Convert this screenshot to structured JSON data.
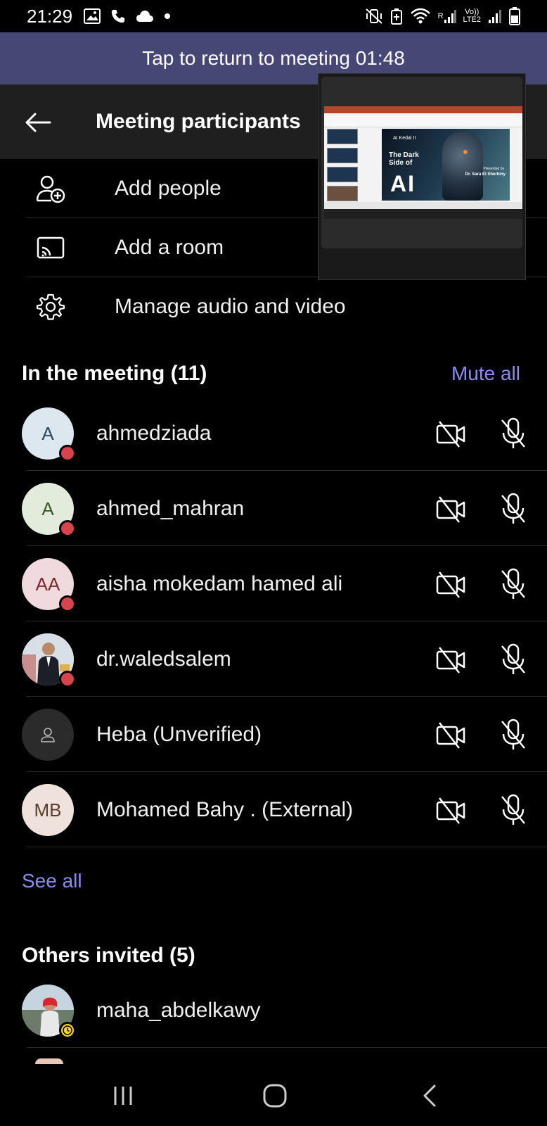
{
  "status_bar": {
    "time": "21:29",
    "network_label_top": "Vo))",
    "network_label_bottom": "LTE2",
    "roaming_label": "R"
  },
  "banner": {
    "text": "Tap to return to meeting 01:48"
  },
  "header": {
    "title": "Meeting participants"
  },
  "actions": [
    {
      "label": "Add people",
      "icon": "add-person-icon"
    },
    {
      "label": "Add a room",
      "icon": "cast-icon"
    },
    {
      "label": "Manage audio and video",
      "icon": "gear-icon"
    }
  ],
  "pip": {
    "slide_kicker": "AI Kedal II",
    "slide_title_line1": "The Dark",
    "slide_title_line2": "Side of",
    "slide_big": "AI",
    "slide_presented": "Presented by",
    "slide_presenter": "Dr. Sara El Sherbiny"
  },
  "in_meeting": {
    "title": "In the meeting (11)",
    "mute_all": "Mute all",
    "participants": [
      {
        "initials": "A",
        "name": "ahmedziada",
        "avatar_bg": "#dde7ef",
        "avatar_fg": "#2d4a63"
      },
      {
        "initials": "A",
        "name": "ahmed_mahran",
        "avatar_bg": "#e3ebdd",
        "avatar_fg": "#3b5a2a"
      },
      {
        "initials": "AA",
        "name": "aisha mokedam hamed ali",
        "avatar_bg": "#f0dadd",
        "avatar_fg": "#7a2a35"
      },
      {
        "initials": "",
        "name": "dr.waledsalem",
        "avatar_bg": "#c9d3dc",
        "avatar_fg": "#222222"
      },
      {
        "initials": "",
        "name": "Heba (Unverified)",
        "avatar_bg": "#2b2b2b",
        "avatar_fg": "#bbbbbb"
      },
      {
        "initials": "MB",
        "name": "Mohamed Bahy . (External)",
        "avatar_bg": "#efe2dc",
        "avatar_fg": "#5a3d30"
      }
    ],
    "see_all": "See all"
  },
  "others_invited": {
    "title": "Others invited (5)",
    "people": [
      {
        "name": "maha_abdelkawy"
      }
    ]
  },
  "colors": {
    "banner": "#464775",
    "link": "#8b8cf0",
    "status_red": "#d9434d",
    "status_away": "#f8d22a"
  }
}
